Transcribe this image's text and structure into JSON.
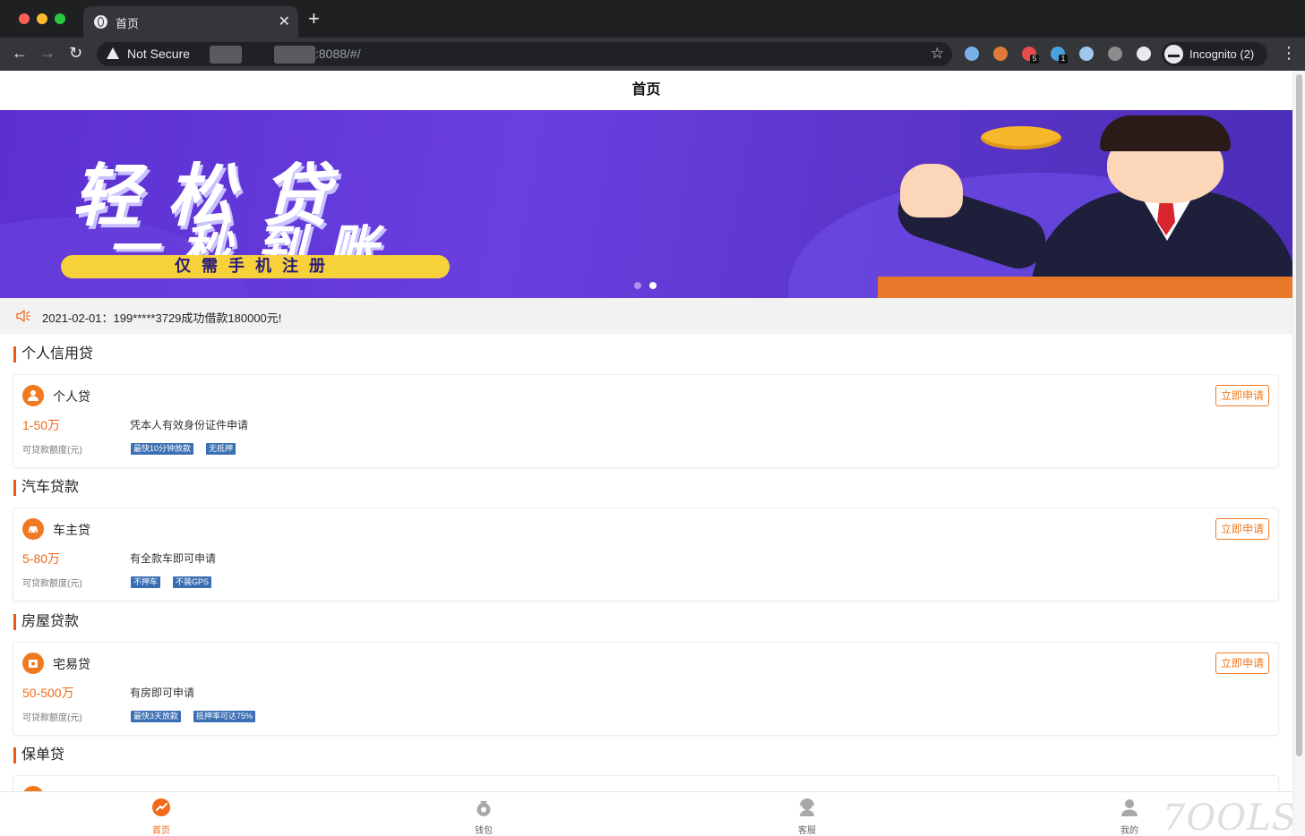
{
  "browser": {
    "tab_title": "首页",
    "close_glyph": "✕",
    "new_tab_glyph": "+",
    "security_label": "Not Secure",
    "url": ":8088/#/",
    "incognito_label": "Incognito (2)",
    "extensions": [
      {
        "name": "ext-globe-icon",
        "color": "#7bb0e8",
        "badge": ""
      },
      {
        "name": "ext-tiger-icon",
        "color": "#e0793a",
        "badge": ""
      },
      {
        "name": "ext-mushroom-icon",
        "color": "#e84b4b",
        "badge": "5"
      },
      {
        "name": "ext-earth-icon",
        "color": "#4aa3e0",
        "badge": "1"
      },
      {
        "name": "ext-cloud-icon",
        "color": "#9fc6ef",
        "badge": ""
      },
      {
        "name": "ext-spy-icon",
        "color": "#8c8c8c",
        "badge": ""
      },
      {
        "name": "extensions-puzzle-icon",
        "color": "#e8eaed",
        "badge": ""
      }
    ]
  },
  "page": {
    "header_title": "首页",
    "banner": {
      "line1": "轻松贷",
      "line2": "一秒到账",
      "pill": "仅需手机注册",
      "active_slide": 2,
      "slide_count": 2
    },
    "notice": "2021-02-01：199*****3729成功借款180000元!",
    "sections": [
      {
        "title": "个人信用贷",
        "product": {
          "name": "个人贷",
          "icon": "person-icon",
          "amount": "1-50万",
          "amount_label": "可贷款额度(元)",
          "desc": "凭本人有效身份证件申请",
          "tags": [
            "最快10分钟放款",
            "无抵押"
          ],
          "button": "立即申请"
        }
      },
      {
        "title": "汽车贷款",
        "product": {
          "name": "车主贷",
          "icon": "car-icon",
          "amount": "5-80万",
          "amount_label": "可贷款额度(元)",
          "desc": "有全款车即可申请",
          "tags": [
            "不押车",
            "不装GPS"
          ],
          "button": "立即申请"
        }
      },
      {
        "title": "房屋贷款",
        "product": {
          "name": "宅易贷",
          "icon": "house-icon",
          "amount": "50-500万",
          "amount_label": "可贷款额度(元)",
          "desc": "有房即可申请",
          "tags": [
            "最快3天放款",
            "抵押率可达75%"
          ],
          "button": "立即申请"
        }
      },
      {
        "title": "保单贷"
      }
    ],
    "tabbar": [
      {
        "label": "首页",
        "icon": "home-icon",
        "active": true
      },
      {
        "label": "钱包",
        "icon": "wallet-icon",
        "active": false
      },
      {
        "label": "客服",
        "icon": "customer-service-icon",
        "active": false
      },
      {
        "label": "我的",
        "icon": "profile-icon",
        "active": false
      }
    ],
    "watermark": "7OOLS",
    "accent_color": "#f06a1a",
    "tag_color": "#3b6fb3"
  }
}
